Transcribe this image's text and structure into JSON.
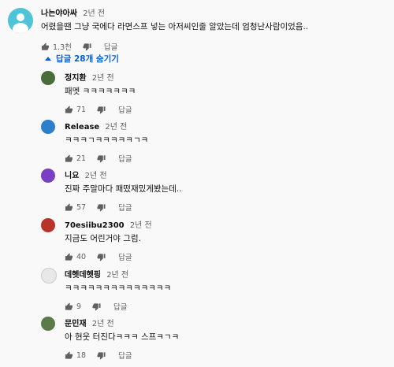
{
  "top_comment": {
    "author": "나는야아싸",
    "time": "2년 전",
    "text": "어렸을땐 그냥 국에다 라면스프 넣는 아저씨인줄 알았는데 엄청난사람이었음..",
    "likes": "1.3천",
    "reply_label": "답글"
  },
  "replies_toggle": {
    "label": "답글 28개 숨기기",
    "color": "#065fd4"
  },
  "replies": [
    {
      "author": "정지환",
      "time": "2년 전",
      "text": "패멧 ㅋㅋㅋㅋㅋㅋㅋ",
      "likes": "71",
      "reply_label": "답글",
      "avatar_color": "#4a6b3a"
    },
    {
      "author": "Release",
      "time": "2년 전",
      "text": "ㅋㅋㅋㄱㅋㅋㅋㅋㅋㄱㅋ",
      "likes": "21",
      "reply_label": "답글",
      "avatar_color": "#2c7fc8"
    },
    {
      "author": "니요",
      "time": "2년 전",
      "text": "진짜 주말마다 패떴재밌게봤는데..",
      "likes": "57",
      "reply_label": "답글",
      "avatar_color": "#7b3fc4"
    },
    {
      "author": "70esiibu2300",
      "time": "2년 전",
      "text": "지금도 어린거야 그럼.",
      "likes": "40",
      "reply_label": "답글",
      "avatar_color": "#b8342a"
    },
    {
      "author": "데헷데헷핑",
      "time": "2년 전",
      "text": "ㅋㅋㅋㅋㅋㅋㅋㅋㅋㅋㅋㅋㅋㅋ",
      "likes": "9",
      "reply_label": "답글",
      "avatar_color": "#e8e8e8"
    },
    {
      "author": "문민재",
      "time": "2년 전",
      "text": "아 현웃 터진다ㅋㅋㅋ 스프ㅋㄱㅋ",
      "likes": "18",
      "reply_label": "답글",
      "avatar_color": "#5a7a4a"
    }
  ]
}
